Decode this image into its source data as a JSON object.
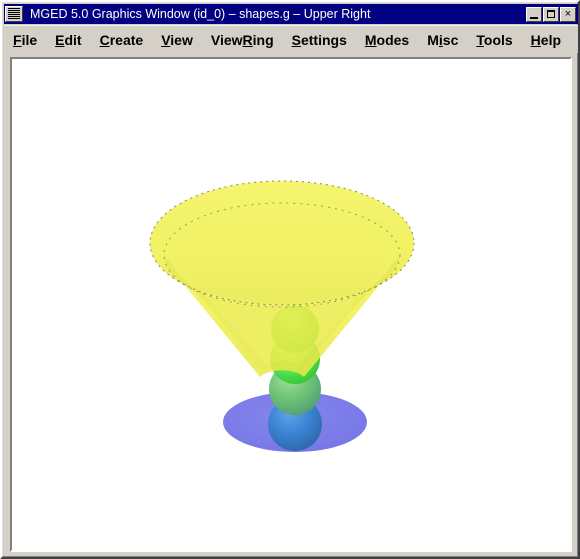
{
  "window": {
    "title": "MGED 5.0 Graphics Window (id_0) – shapes.g – Upper Right",
    "sysmenu_icon": "system-menu-icon",
    "buttons": {
      "minimize": "minimize-icon",
      "maximize": "maximize-icon",
      "close": "×"
    },
    "colors": {
      "titlebar": "#000080",
      "titlebar_text": "#ffffff",
      "chrome": "#d4d0c8",
      "canvas": "#ffffff"
    }
  },
  "menubar": {
    "items": [
      {
        "label": "File",
        "mnemonic": "F",
        "before": "",
        "after": "ile"
      },
      {
        "label": "Edit",
        "mnemonic": "E",
        "before": "",
        "after": "dit"
      },
      {
        "label": "Create",
        "mnemonic": "C",
        "before": "",
        "after": "reate"
      },
      {
        "label": "View",
        "mnemonic": "V",
        "before": "",
        "after": "iew"
      },
      {
        "label": "ViewRing",
        "mnemonic": "R",
        "before": "View",
        "after": "ing"
      },
      {
        "label": "Settings",
        "mnemonic": "S",
        "before": "",
        "after": "ettings"
      },
      {
        "label": "Modes",
        "mnemonic": "M",
        "before": "",
        "after": "odes"
      },
      {
        "label": "Misc",
        "mnemonic": "i",
        "before": "M",
        "after": "sc"
      },
      {
        "label": "Tools",
        "mnemonic": "T",
        "before": "",
        "after": "ools"
      },
      {
        "label": "Help",
        "mnemonic": "H",
        "before": "",
        "after": "elp"
      }
    ]
  },
  "viewport": {
    "name": "3d-graphics-viewport",
    "background": "#ffffff",
    "scene_objects": [
      {
        "name": "cone-goblet-bowl",
        "shape": "cone",
        "color": "#f0f04d",
        "shade_color": "#dede3c",
        "edge_color": "#4a4a1e",
        "opacity": 0.82
      },
      {
        "name": "stem-sphere-1",
        "shape": "sphere",
        "color": "#5ef05e"
      },
      {
        "name": "stem-sphere-2",
        "shape": "sphere",
        "color": "#5ef05e"
      },
      {
        "name": "stem-sphere-3",
        "shape": "sphere",
        "color": "#6fc86f"
      },
      {
        "name": "stem-sphere-4",
        "shape": "sphere",
        "color": "#3c82d2"
      },
      {
        "name": "base-ellipse-disk",
        "shape": "ellipse",
        "color": "#7b7be8"
      }
    ]
  }
}
